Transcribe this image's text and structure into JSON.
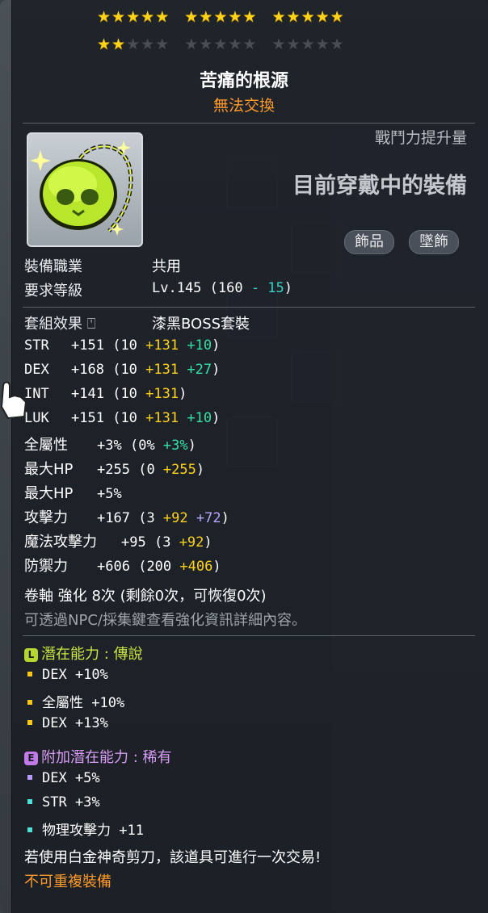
{
  "stars": {
    "filled": 17,
    "total": 30
  },
  "item": {
    "name": "苦痛的根源",
    "trade_status": "無法交換",
    "power_label": "戰鬥力提升量",
    "equipped_text": "目前穿戴中的裝備",
    "tags": [
      "飾品",
      "墜飾"
    ]
  },
  "requirements": {
    "job_label": "裝備職業",
    "job_value": "共用",
    "level_label": "要求等級",
    "level_value": "Lv.145 (160",
    "level_minus": " - 15",
    "level_close": ")"
  },
  "set": {
    "label": "套組效果",
    "value": "漆黑BOSS套裝"
  },
  "stats": [
    {
      "name": "STR",
      "total": "+151",
      "base": "(10 ",
      "p1": "+131",
      "p2": " +10",
      "close": ")",
      "p2_color": "green"
    },
    {
      "name": "DEX",
      "total": "+168",
      "base": "(10 ",
      "p1": "+131",
      "p2": " +27",
      "close": ")",
      "p2_color": "green"
    },
    {
      "name": "INT",
      "total": "+141",
      "base": "(10 ",
      "p1": "+131",
      "p2": "",
      "close": ")",
      "p2_color": "green"
    },
    {
      "name": "LUK",
      "total": "+151",
      "base": "(10 ",
      "p1": "+131",
      "p2": " +10",
      "close": ")",
      "p2_color": "green"
    },
    {
      "name": "全屬性",
      "total": "+3%",
      "base": "(0% ",
      "p1": "",
      "p2": "+3%",
      "close": ")",
      "p2_color": "green"
    },
    {
      "name": "最大HP",
      "total": "+255",
      "base": "(0 ",
      "p1": "+255",
      "p2": "",
      "close": ")",
      "p2_color": "green"
    },
    {
      "name": "最大HP",
      "total": "+5%",
      "base": "",
      "p1": "",
      "p2": "",
      "close": "",
      "p2_color": "green"
    },
    {
      "name": "攻擊力",
      "total": "+167",
      "base": "(3 ",
      "p1": "+92",
      "p2": " +72",
      "close": ")",
      "p2_color": "purple"
    },
    {
      "name": "魔法攻擊力",
      "total": "+95",
      "base": "(3 ",
      "p1": "+92",
      "p2": "",
      "close": ")",
      "p2_color": "green"
    },
    {
      "name": "防禦力",
      "total": "+606",
      "base": "(200 ",
      "p1": "+406",
      "p2": "",
      "close": ")",
      "p2_color": "green"
    }
  ],
  "scroll": {
    "text": "卷軸 強化 8次 (剩餘0次，可恢復0次)",
    "hint": "可透過NPC/採集鍵查看強化資訊詳細內容。"
  },
  "potential": {
    "icon": "L",
    "title": "潛在能力 : 傳說",
    "lines": [
      "DEX +10%",
      "全屬性 +10%",
      "DEX +13%"
    ]
  },
  "bonus_potential": {
    "icon": "E",
    "title": "附加潛在能力 : 稀有",
    "lines": [
      "DEX +5%",
      "STR +3%",
      "物理攻擊力 +11"
    ]
  },
  "footer": {
    "scissors": "若使用白金神奇剪刀，該道具可進行一次交易!",
    "unique": "不可重複裝備"
  },
  "colors": {
    "star": "#ffd21a",
    "yellow_bonus": "#ffd21a",
    "green_bonus": "#35e0a5",
    "purple_bonus": "#b8a6ff",
    "trade_orange": "#ff9a2a",
    "potential_legendary": "#cbe640",
    "bonus_rare": "#d79cf5"
  }
}
